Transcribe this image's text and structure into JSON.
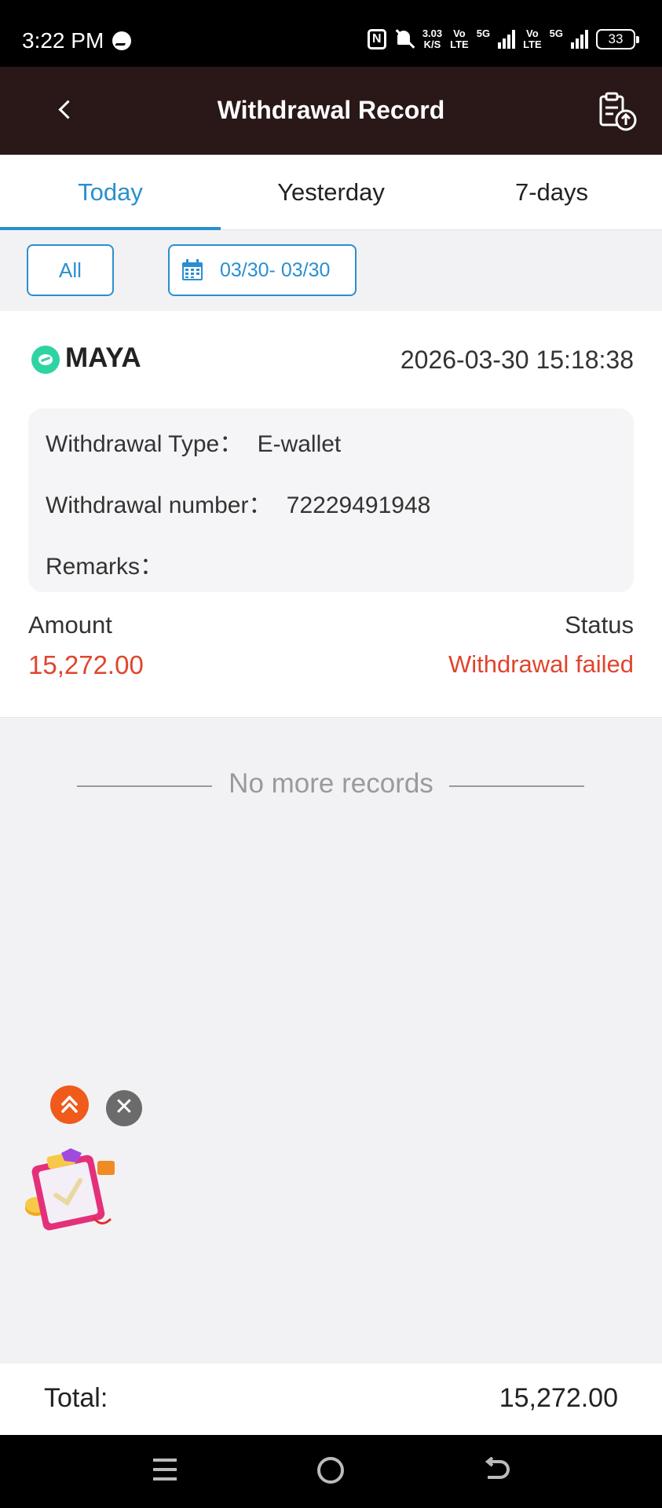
{
  "status_bar": {
    "time": "3:22 PM",
    "nfc": "N",
    "speed_value": "3.03",
    "speed_unit": "K/S",
    "sim1_vo": "Vo",
    "sim1_lte": "LTE",
    "sim1_net": "5G",
    "sim2_vo": "Vo",
    "sim2_lte": "LTE",
    "sim2_net": "5G",
    "battery": "33"
  },
  "header": {
    "title": "Withdrawal Record",
    "back_icon": "chevron-left-icon",
    "upload_icon": "clipboard-upload-icon"
  },
  "tabs": [
    {
      "label": "Today",
      "active": true
    },
    {
      "label": "Yesterday",
      "active": false
    },
    {
      "label": "7-days",
      "active": false
    }
  ],
  "filters": {
    "all_label": "All",
    "date_range": "03/30- 03/30",
    "date_icon": "calendar-icon"
  },
  "record": {
    "provider": "MAYA",
    "datetime": "2026-03-30 15:18:38",
    "type_label": "Withdrawal Type：",
    "type_value": "E-wallet",
    "number_label": "Withdrawal number：",
    "number_value": "72229491948",
    "remarks_label": "Remarks：",
    "amount_label": "Amount",
    "amount_value": "15,272.00",
    "status_label": "Status",
    "status_value": "Withdrawal failed"
  },
  "list_end": "No more records",
  "total": {
    "label": "Total:",
    "value": "15,272.00"
  },
  "colors": {
    "accent": "#2a8fd0",
    "header_bg": "#2a1818",
    "error": "#e0452d",
    "maya_green": "#2ed3a2"
  }
}
